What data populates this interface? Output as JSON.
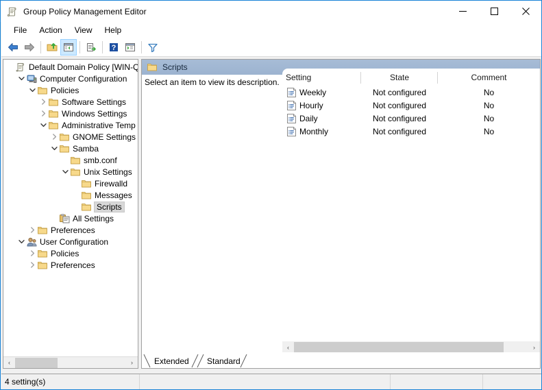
{
  "window": {
    "title": "Group Policy Management Editor",
    "icon": "policy-scroll-icon",
    "minimize_label": "—",
    "maximize_label": "□",
    "close_label": "✕"
  },
  "menu": {
    "items": [
      {
        "label": "File"
      },
      {
        "label": "Action"
      },
      {
        "label": "View"
      },
      {
        "label": "Help"
      }
    ]
  },
  "toolbar": {
    "buttons": [
      {
        "name": "back-icon",
        "tooltip": "Back"
      },
      {
        "name": "forward-icon",
        "tooltip": "Forward"
      },
      {
        "name": "up-folder-icon",
        "tooltip": "Up One Level"
      },
      {
        "name": "show-hide-tree-icon",
        "tooltip": "Show/Hide Console Tree"
      },
      {
        "name": "export-list-icon",
        "tooltip": "Export List"
      },
      {
        "name": "help-icon",
        "tooltip": "Help"
      },
      {
        "name": "properties-icon",
        "tooltip": "Properties"
      },
      {
        "name": "filter-icon",
        "tooltip": "Filter"
      }
    ]
  },
  "tree": {
    "items": [
      {
        "label": "Default Domain Policy [WIN-QL",
        "depth": 0,
        "chevron": "none",
        "icon": "policy-scroll-icon",
        "selected": false
      },
      {
        "label": "Computer Configuration",
        "depth": 1,
        "chevron": "expanded",
        "icon": "computer-icon",
        "selected": false
      },
      {
        "label": "Policies",
        "depth": 2,
        "chevron": "expanded",
        "icon": "folder-icon",
        "selected": false
      },
      {
        "label": "Software Settings",
        "depth": 3,
        "chevron": "collapsed",
        "icon": "folder-icon",
        "selected": false
      },
      {
        "label": "Windows Settings",
        "depth": 3,
        "chevron": "collapsed",
        "icon": "folder-icon",
        "selected": false
      },
      {
        "label": "Administrative Temp",
        "depth": 3,
        "chevron": "expanded",
        "icon": "folder-icon",
        "selected": false
      },
      {
        "label": "GNOME Settings",
        "depth": 4,
        "chevron": "collapsed",
        "icon": "folder-icon",
        "selected": false
      },
      {
        "label": "Samba",
        "depth": 4,
        "chevron": "expanded",
        "icon": "folder-icon",
        "selected": false
      },
      {
        "label": "smb.conf",
        "depth": 5,
        "chevron": "none",
        "icon": "folder-icon",
        "selected": false
      },
      {
        "label": "Unix Settings",
        "depth": 5,
        "chevron": "expanded",
        "icon": "folder-icon",
        "selected": false
      },
      {
        "label": "Firewalld",
        "depth": 6,
        "chevron": "none",
        "icon": "folder-icon",
        "selected": false
      },
      {
        "label": "Messages",
        "depth": 6,
        "chevron": "none",
        "icon": "folder-icon",
        "selected": false
      },
      {
        "label": "Scripts",
        "depth": 6,
        "chevron": "none",
        "icon": "folder-icon",
        "selected": true
      },
      {
        "label": "All Settings",
        "depth": 4,
        "chevron": "none",
        "icon": "all-settings-icon",
        "selected": false
      },
      {
        "label": "Preferences",
        "depth": 2,
        "chevron": "collapsed",
        "icon": "folder-icon",
        "selected": false
      },
      {
        "label": "User Configuration",
        "depth": 1,
        "chevron": "expanded",
        "icon": "user-icon",
        "selected": false
      },
      {
        "label": "Policies",
        "depth": 2,
        "chevron": "collapsed",
        "icon": "folder-icon",
        "selected": false
      },
      {
        "label": "Preferences",
        "depth": 2,
        "chevron": "collapsed",
        "icon": "folder-icon",
        "selected": false
      }
    ]
  },
  "right_pane": {
    "header_title": "Scripts",
    "header_icon": "folder-icon",
    "description": "Select an item to view its description.",
    "columns": [
      {
        "label": "Setting"
      },
      {
        "label": "State"
      },
      {
        "label": "Comment"
      }
    ],
    "rows": [
      {
        "setting": "Weekly",
        "state": "Not configured",
        "comment": "No",
        "icon": "policy-setting-icon"
      },
      {
        "setting": "Hourly",
        "state": "Not configured",
        "comment": "No",
        "icon": "policy-setting-icon"
      },
      {
        "setting": "Daily",
        "state": "Not configured",
        "comment": "No",
        "icon": "policy-setting-icon"
      },
      {
        "setting": "Monthly",
        "state": "Not configured",
        "comment": "No",
        "icon": "policy-setting-icon"
      }
    ],
    "tabs": [
      {
        "label": "Extended",
        "active": false
      },
      {
        "label": "Standard",
        "active": true
      }
    ]
  },
  "scrollbars": {
    "left_arrow": "‹",
    "right_arrow": "›"
  },
  "statusbar": {
    "cells": [
      {
        "text": "4 setting(s)"
      },
      {
        "text": ""
      },
      {
        "text": ""
      },
      {
        "text": ""
      }
    ]
  },
  "colors": {
    "window_border": "#1883d7",
    "header_gradient_top": "#a7bcd6",
    "header_gradient_bottom": "#9cb3d0",
    "selection": "#d8d8d8",
    "folder": "#f7d98b",
    "toolbar_active": "#cce8ff"
  }
}
